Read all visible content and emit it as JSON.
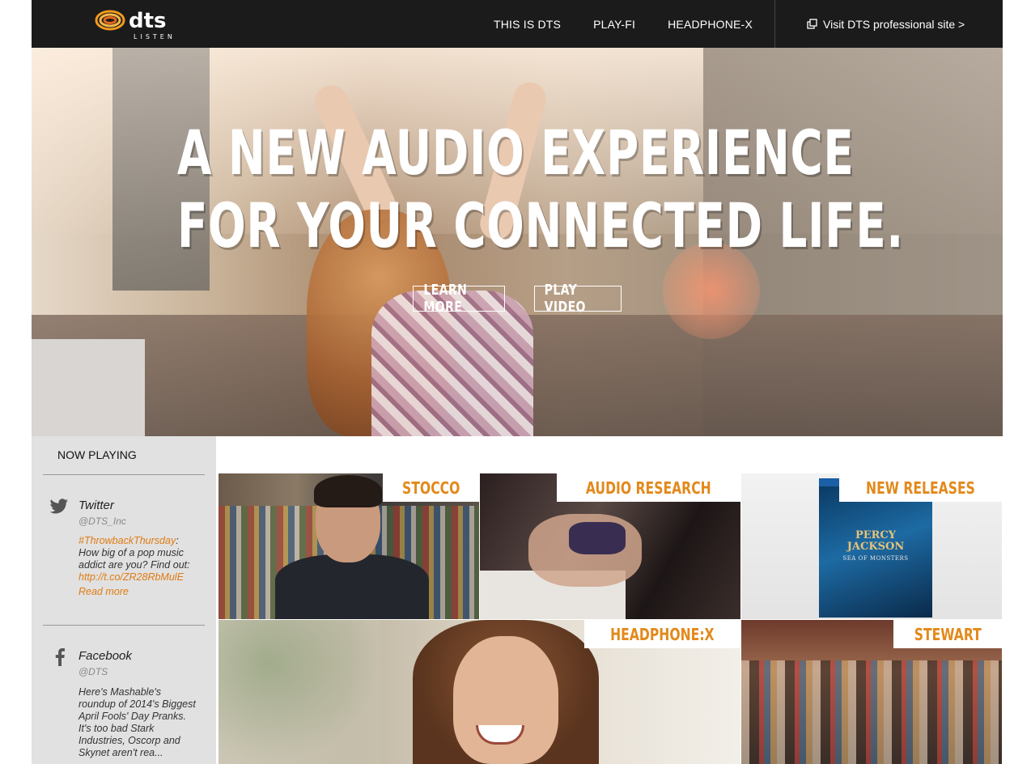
{
  "header": {
    "logo_alt": "dts LISTEN",
    "logo_text": "dts",
    "logo_sub": "LISTEN",
    "nav": [
      {
        "label": "THIS IS DTS"
      },
      {
        "label": "PLAY-FI"
      },
      {
        "label": "HEADPHONE-X"
      }
    ],
    "pro_link_label": "Visit DTS professional site >"
  },
  "hero": {
    "headline_line1": "A NEW AUDIO EXPERIENCE",
    "headline_line2": "FOR YOUR CONNECTED LIFE.",
    "learn_more_label": "LEARN MORE",
    "play_video_label": "PLAY VIDEO"
  },
  "sidebar": {
    "title": "NOW PLAYING",
    "twitter": {
      "name": "Twitter",
      "handle": "@DTS_Inc",
      "hashtag": "#ThrowbackThursday",
      "text": ": How big of a pop music addict are you? Find out: ",
      "link": "http://t.co/ZR28RbMulE",
      "read_more": "Read more"
    },
    "facebook": {
      "name": "Facebook",
      "handle": "@DTS",
      "text": "Here's Mashable's roundup of 2014's Biggest April Fools' Day Pranks. It's too bad Stark Industries, Oscorp and Skynet aren't rea..."
    }
  },
  "tiles": [
    {
      "label": "STOCCO"
    },
    {
      "label": "AUDIO RESEARCH"
    },
    {
      "label": "NEW RELEASES"
    },
    {
      "label": "HEADPHONE:X"
    },
    {
      "label": "STEWART"
    }
  ],
  "new_release_cover": {
    "title": "PERCY JACKSON",
    "subtitle": "SEA OF MONSTERS"
  },
  "colors": {
    "accent": "#e3891b",
    "topbar": "#1b1b1b",
    "sidebar_bg": "#e1e1e1",
    "link": "#e07b12"
  },
  "icons": {
    "twitter": "twitter-bird-icon",
    "facebook": "facebook-f-icon",
    "external": "external-link-icon"
  }
}
